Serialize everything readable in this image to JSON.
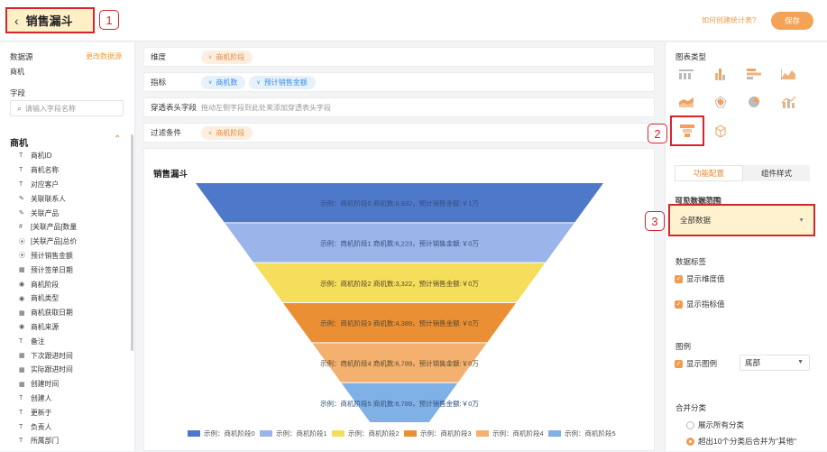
{
  "header": {
    "title": "销售漏斗",
    "back_icon": "back-arrow-icon",
    "callouts": [
      "1",
      "2",
      "3"
    ],
    "help_link": "如何创建统计表?",
    "save_label": "保存"
  },
  "sidebar": {
    "datasource_label": "数据源",
    "datasource_change": "更改数据源",
    "datasource_value": "商机",
    "fields_label": "字段",
    "search_placeholder": "请输入字段名称",
    "group_label": "商机",
    "fields": [
      {
        "icon": "T",
        "label": "商机ID"
      },
      {
        "icon": "T",
        "label": "商机名称"
      },
      {
        "icon": "T",
        "label": "对应客户"
      },
      {
        "icon": "link",
        "label": "关联联系人"
      },
      {
        "icon": "link",
        "label": "关联产品"
      },
      {
        "icon": "#",
        "label": "[关联产品]数量"
      },
      {
        "icon": "target",
        "label": "[关联产品]总价"
      },
      {
        "icon": "target",
        "label": "预计销售金额"
      },
      {
        "icon": "calendar",
        "label": "预计签单日期"
      },
      {
        "icon": "radio",
        "label": "商机阶段"
      },
      {
        "icon": "radio",
        "label": "商机类型"
      },
      {
        "icon": "calendar",
        "label": "商机获取日期"
      },
      {
        "icon": "radio",
        "label": "商机来源"
      },
      {
        "icon": "T",
        "label": "备注"
      },
      {
        "icon": "calendar",
        "label": "下次跟进时间"
      },
      {
        "icon": "calendar",
        "label": "实际跟进时间"
      },
      {
        "icon": "calendar",
        "label": "创建时间"
      },
      {
        "icon": "T",
        "label": "创建人"
      },
      {
        "icon": "T",
        "label": "更新于"
      },
      {
        "icon": "T",
        "label": "负责人"
      },
      {
        "icon": "T",
        "label": "所属部门"
      }
    ]
  },
  "config": {
    "dimension_label": "维度",
    "dimension_pill": "商机阶段",
    "metric_label": "指标",
    "metric_pills": [
      "商机数",
      "预计销售金额"
    ],
    "pivot_label": "穿透表头字段",
    "pivot_hint": "拖动左侧字段到此处来添加穿透表头字段",
    "filter_label": "过滤条件",
    "filter_pill": "商机阶段"
  },
  "chart_data": {
    "type": "funnel",
    "title": "销售漏斗",
    "stages": [
      {
        "label": "示例：商机阶段0  商机数:8,932，预计销售金额:￥1万",
        "legend": "示例：商机阶段0",
        "color": "#4e78c9"
      },
      {
        "label": "示例：商机阶段1  商机数:6,223，预计销售金额:￥0万",
        "legend": "示例：商机阶段1",
        "color": "#9bb5ea"
      },
      {
        "label": "示例：商机阶段2  商机数:3,322，预计销售金额:￥0万",
        "legend": "示例：商机阶段2",
        "color": "#f5de5b"
      },
      {
        "label": "示例：商机阶段3  商机数:4,389，预计销售金额:￥0万",
        "legend": "示例：商机阶段3",
        "color": "#eb8f35"
      },
      {
        "label": "示例：商机阶段4  商机数:6,789，预计销售金额:￥0万",
        "legend": "示例：商机阶段4",
        "color": "#f3b06f"
      },
      {
        "label": "示例：商机阶段5  商机数:6,789，预计销售金额:￥0万",
        "legend": "示例：商机阶段5",
        "color": "#7fb0e6"
      }
    ],
    "legend_position": "bottom"
  },
  "right_panel": {
    "chart_type_label": "图表类型",
    "chart_type_icons": [
      "table-icon",
      "bar-chart-icon",
      "horizontal-bar-icon",
      "area-chart-icon",
      "stacked-area-icon",
      "radar-icon",
      "pie-chart-icon",
      "combo-chart-icon",
      "funnel-icon",
      "3d-box-icon"
    ],
    "tab_function": "功能配置",
    "tab_style": "组件样式",
    "visible_range_label": "可见数据范围",
    "visible_range_value": "全部数据",
    "data_label_title": "数据标签",
    "show_dimension": "显示维度值",
    "show_metric": "显示指标值",
    "legend_title": "图例",
    "show_legend": "显示图例",
    "legend_position_value": "底部",
    "merge_title": "合并分类",
    "merge_all": "展示所有分类",
    "merge_over10": "超出10个分类后合并为\"其他\""
  }
}
